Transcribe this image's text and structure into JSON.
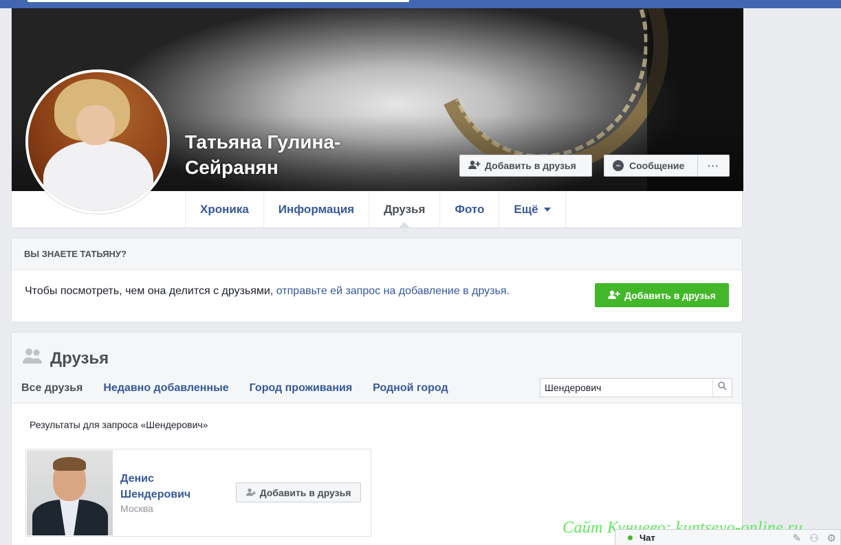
{
  "profile": {
    "name": "Татьяна Гулина-Сейранян",
    "add_friend_label": "Добавить в друзья",
    "message_label": "Сообщение",
    "more_label": "···"
  },
  "tabs": [
    {
      "label": "Хроника"
    },
    {
      "label": "Информация"
    },
    {
      "label": "Друзья"
    },
    {
      "label": "Фото"
    },
    {
      "label": "Ещё"
    }
  ],
  "know": {
    "heading": "ВЫ ЗНАЕТЕ ТАТЬЯНУ?",
    "text": "Чтобы посмотреть, чем она делится с друзьями,",
    "link": "отправьте ей запрос на добавление в друзья.",
    "button_label": "Добавить в друзья"
  },
  "friends": {
    "title": "Друзья",
    "tabs": [
      {
        "label": "Все друзья"
      },
      {
        "label": "Недавно добавленные"
      },
      {
        "label": "Город проживания"
      },
      {
        "label": "Родной город"
      }
    ],
    "search_value": "Шендерович",
    "results_label": "Результаты для запроса «Шендерович»",
    "result": {
      "name": "Денис Шендерович",
      "city": "Москва",
      "add_label": "Добавить в друзья"
    }
  },
  "watermark": "Сайт Кунцево:  kuntsevo-online.ru",
  "chat": {
    "label": "Чат"
  },
  "colors": {
    "fb_blue": "#4267b2",
    "link": "#365899",
    "green": "#42b72a"
  }
}
